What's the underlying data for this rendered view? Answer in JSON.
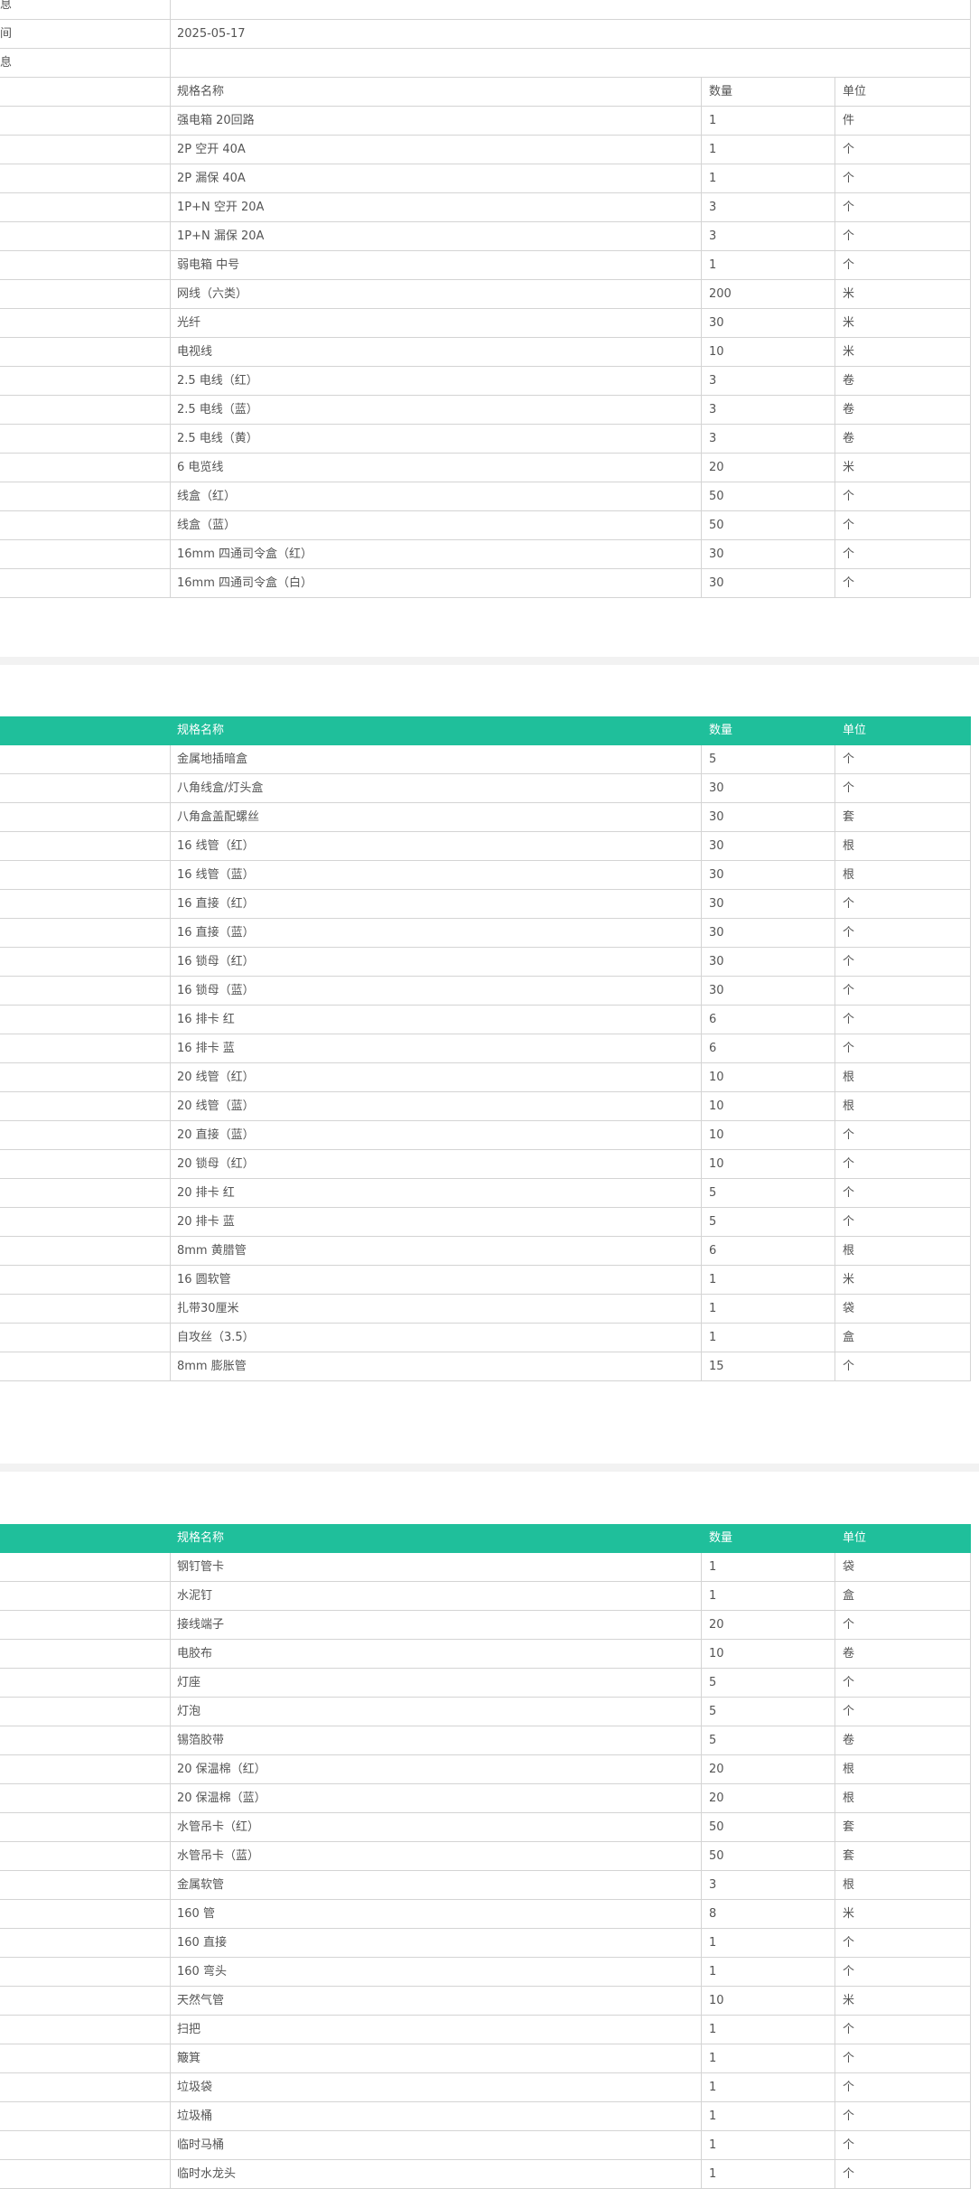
{
  "info": {
    "row0_label": "息",
    "row1_label": "间",
    "row1_value": "2025-05-17",
    "row2_label": "息"
  },
  "section1": {
    "header": {
      "name": "规格名称",
      "qty": "数量",
      "unit": "单位"
    },
    "items": [
      {
        "name": "强电箱 20回路",
        "qty": "1",
        "unit": "件"
      },
      {
        "name": "2P 空开 40A",
        "qty": "1",
        "unit": "个"
      },
      {
        "name": "2P 漏保 40A",
        "qty": "1",
        "unit": "个"
      },
      {
        "name": "1P+N 空开 20A",
        "qty": "3",
        "unit": "个"
      },
      {
        "name": "1P+N 漏保 20A",
        "qty": "3",
        "unit": "个"
      },
      {
        "name": "弱电箱 中号",
        "qty": "1",
        "unit": "个"
      },
      {
        "name": "网线（六类）",
        "qty": "200",
        "unit": "米"
      },
      {
        "name": "光纤",
        "qty": "30",
        "unit": "米"
      },
      {
        "name": "电视线",
        "qty": "10",
        "unit": "米"
      },
      {
        "name": "2.5 电线（红）",
        "qty": "3",
        "unit": "卷"
      },
      {
        "name": "2.5 电线（蓝）",
        "qty": "3",
        "unit": "卷"
      },
      {
        "name": "2.5 电线（黄）",
        "qty": "3",
        "unit": "卷"
      },
      {
        "name": "6 电览线",
        "qty": "20",
        "unit": "米"
      },
      {
        "name": "线盒（红）",
        "qty": "50",
        "unit": "个"
      },
      {
        "name": "线盒（蓝）",
        "qty": "50",
        "unit": "个"
      },
      {
        "name": "16mm 四通司令盒（红）",
        "qty": "30",
        "unit": "个"
      },
      {
        "name": "16mm 四通司令盒（白）",
        "qty": "30",
        "unit": "个"
      }
    ]
  },
  "section2": {
    "header": {
      "name": "规格名称",
      "qty": "数量",
      "unit": "单位"
    },
    "items": [
      {
        "name": "金属地插暗盒",
        "qty": "5",
        "unit": "个"
      },
      {
        "name": "八角线盒/灯头盒",
        "qty": "30",
        "unit": "个"
      },
      {
        "name": "八角盒盖配螺丝",
        "qty": "30",
        "unit": "套"
      },
      {
        "name": "16 线管（红）",
        "qty": "30",
        "unit": "根"
      },
      {
        "name": "16 线管（蓝）",
        "qty": "30",
        "unit": "根"
      },
      {
        "name": "16 直接（红）",
        "qty": "30",
        "unit": "个"
      },
      {
        "name": "16 直接（蓝）",
        "qty": "30",
        "unit": "个"
      },
      {
        "name": "16 锁母（红）",
        "qty": "30",
        "unit": "个"
      },
      {
        "name": "16 锁母（蓝）",
        "qty": "30",
        "unit": "个"
      },
      {
        "name": "16 排卡 红",
        "qty": "6",
        "unit": "个"
      },
      {
        "name": "16 排卡 蓝",
        "qty": "6",
        "unit": "个"
      },
      {
        "name": "20 线管（红）",
        "qty": "10",
        "unit": "根"
      },
      {
        "name": "20 线管（蓝）",
        "qty": "10",
        "unit": "根"
      },
      {
        "name": "20 直接（蓝）",
        "qty": "10",
        "unit": "个"
      },
      {
        "name": "20 锁母（红）",
        "qty": "10",
        "unit": "个"
      },
      {
        "name": "20 排卡 红",
        "qty": "5",
        "unit": "个"
      },
      {
        "name": "20 排卡 蓝",
        "qty": "5",
        "unit": "个"
      },
      {
        "name": "8mm 黄腊管",
        "qty": "6",
        "unit": "根"
      },
      {
        "name": "16 圆软管",
        "qty": "1",
        "unit": "米"
      },
      {
        "name": "扎带30厘米",
        "qty": "1",
        "unit": "袋"
      },
      {
        "name": "自攻丝（3.5）",
        "qty": "1",
        "unit": "盒"
      },
      {
        "name": "8mm 膨胀管",
        "qty": "15",
        "unit": "个"
      }
    ]
  },
  "section3": {
    "header": {
      "name": "规格名称",
      "qty": "数量",
      "unit": "单位"
    },
    "items": [
      {
        "name": "钢钉管卡",
        "qty": "1",
        "unit": "袋"
      },
      {
        "name": "水泥钉",
        "qty": "1",
        "unit": "盒"
      },
      {
        "name": "接线端子",
        "qty": "20",
        "unit": "个"
      },
      {
        "name": "电胶布",
        "qty": "10",
        "unit": "卷"
      },
      {
        "name": "灯座",
        "qty": "5",
        "unit": "个"
      },
      {
        "name": "灯泡",
        "qty": "5",
        "unit": "个"
      },
      {
        "name": "锡箔胶带",
        "qty": "5",
        "unit": "卷"
      },
      {
        "name": "20 保温棉（红）",
        "qty": "20",
        "unit": "根"
      },
      {
        "name": "20 保温棉（蓝）",
        "qty": "20",
        "unit": "根"
      },
      {
        "name": "水管吊卡（红）",
        "qty": "50",
        "unit": "套"
      },
      {
        "name": "水管吊卡（蓝）",
        "qty": "50",
        "unit": "套"
      },
      {
        "name": "金属软管",
        "qty": "3",
        "unit": "根"
      },
      {
        "name": "160 管",
        "qty": "8",
        "unit": "米"
      },
      {
        "name": "160 直接",
        "qty": "1",
        "unit": "个"
      },
      {
        "name": "160 弯头",
        "qty": "1",
        "unit": "个"
      },
      {
        "name": "天然气管",
        "qty": "10",
        "unit": "米"
      },
      {
        "name": "扫把",
        "qty": "1",
        "unit": "个"
      },
      {
        "name": "簸箕",
        "qty": "1",
        "unit": "个"
      },
      {
        "name": "垃圾袋",
        "qty": "1",
        "unit": "个"
      },
      {
        "name": "垃圾桶",
        "qty": "1",
        "unit": "个"
      },
      {
        "name": "临时马桶",
        "qty": "1",
        "unit": "个"
      },
      {
        "name": "临时水龙头",
        "qty": "1",
        "unit": "个"
      }
    ]
  }
}
